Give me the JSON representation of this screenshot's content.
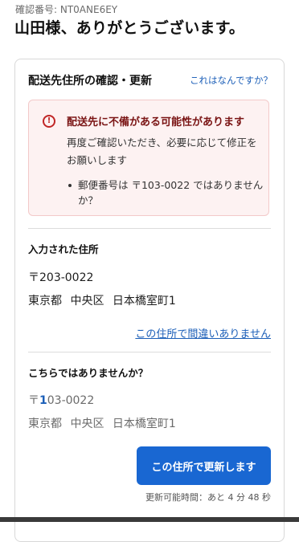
{
  "header": {
    "confirmation_number": "確認番号: NT0ANE6EY",
    "greeting": "山田様、ありがとうございます。"
  },
  "card": {
    "title": "配送先住所の確認・更新",
    "help_link": "これはなんですか？"
  },
  "warning": {
    "icon": "exclamation-circle-icon",
    "title": "配送先に不備がある可能性があります",
    "body": "再度ご確認いただき、必要に応じて修正をお願いします",
    "items": [
      "郵便番号は 〒103-0022 ではありませんか？"
    ],
    "color": "#c02626"
  },
  "entered": {
    "label": "入力された住所",
    "zip": "〒203-0022",
    "address": "東京都 中央区 日本橋室町1",
    "confirm_link": "この住所で間違いありません"
  },
  "suggested": {
    "label": "こちらではありませんか？",
    "zip_prefix": "〒",
    "zip_changed": "1",
    "zip_rest": "03-0022",
    "address": "東京都 中央区 日本橋室町1",
    "button": "この住所で更新します",
    "time_note": "更新可能時間：あと 4 分 48 秒"
  },
  "colors": {
    "accent": "#1967d2",
    "link": "#1c5fb8",
    "warning_bg": "#fdf2f2"
  }
}
